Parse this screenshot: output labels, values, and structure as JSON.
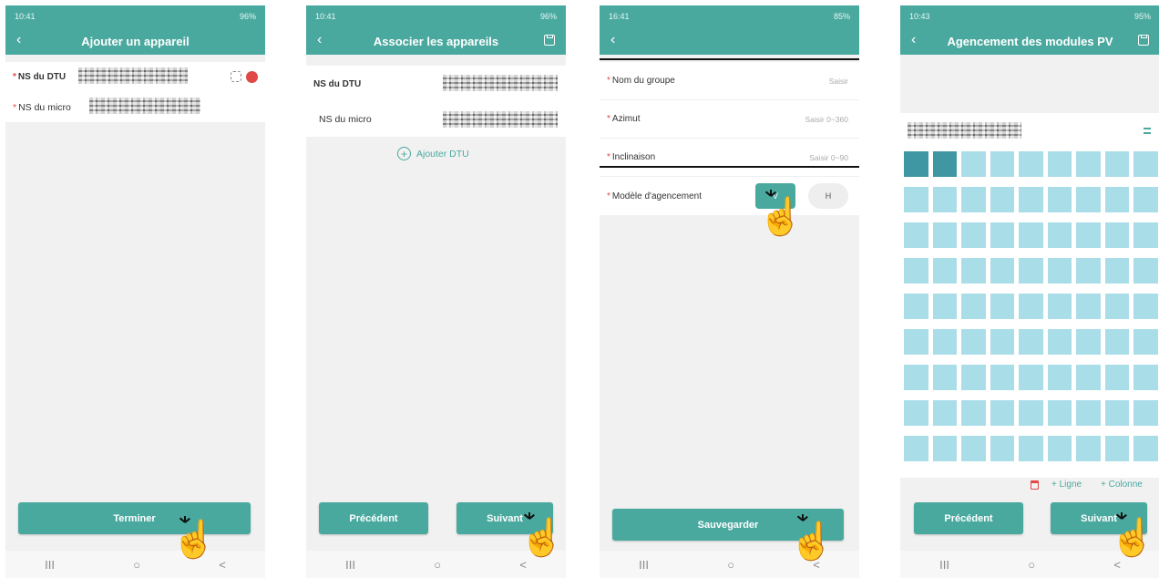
{
  "screens": [
    {
      "status_time": "10:41",
      "status_right": "96%",
      "title": "Ajouter un appareil",
      "row1_label": "NS du DTU",
      "row2_label": "NS du micro",
      "finish": "Terminer",
      "nav": [
        "III",
        "○",
        "<"
      ]
    },
    {
      "status_time": "10:41",
      "status_right": "96%",
      "title": "Associer les appareils",
      "row1_label": "NS du DTU",
      "row2_label": "NS du micro",
      "add_dtu": "Ajouter DTU",
      "prev": "Précédent",
      "next": "Suivant",
      "nav": [
        "III",
        "○",
        "<"
      ]
    },
    {
      "status_time": "16:41",
      "status_right": "85%",
      "fields": [
        {
          "label": "Nom du groupe",
          "placeholder": "Saisir"
        },
        {
          "label": "Azimut",
          "placeholder": "Saisir 0~360"
        },
        {
          "label": "Inclinaison",
          "placeholder": "Saisir 0~90"
        }
      ],
      "layout_label": "Modèle d'agencement",
      "layout_v": "V",
      "layout_h": "H",
      "save": "Sauvegarder",
      "nav": [
        "III",
        "○",
        "<"
      ]
    },
    {
      "status_time": "10:43",
      "status_right": "95%",
      "title": "Agencement des modules PV",
      "add_row": "+ Ligne",
      "add_col": "+ Colonne",
      "prev": "Précédent",
      "next": "Suivant",
      "nav": [
        "III",
        "○",
        "<"
      ]
    }
  ],
  "colors": {
    "accent": "#4aa99f",
    "required": "#e04848",
    "module": "#a9dde8",
    "module_selected": "#3f97a3"
  }
}
